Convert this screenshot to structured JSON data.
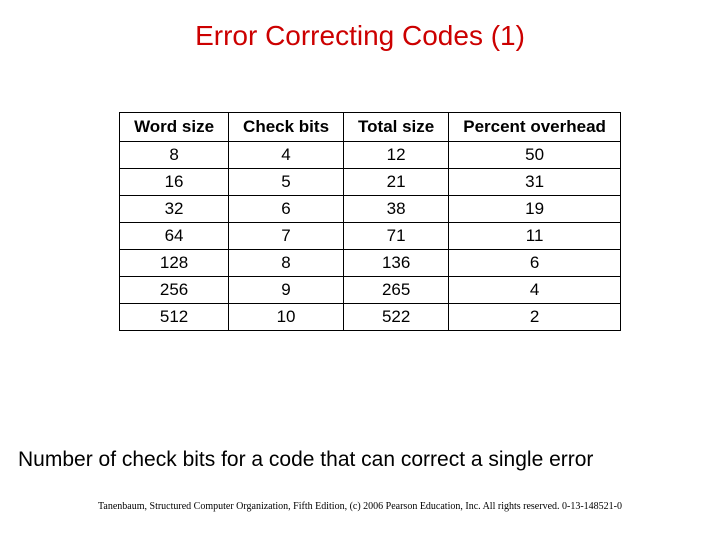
{
  "title": "Error Correcting Codes (1)",
  "chart_data": {
    "type": "table",
    "headers": [
      "Word size",
      "Check bits",
      "Total size",
      "Percent overhead"
    ],
    "rows": [
      [
        "8",
        "4",
        "12",
        "50"
      ],
      [
        "16",
        "5",
        "21",
        "31"
      ],
      [
        "32",
        "6",
        "38",
        "19"
      ],
      [
        "64",
        "7",
        "71",
        "11"
      ],
      [
        "128",
        "8",
        "136",
        "6"
      ],
      [
        "256",
        "9",
        "265",
        "4"
      ],
      [
        "512",
        "10",
        "522",
        "2"
      ]
    ]
  },
  "caption": "Number of check bits for a code that can correct a single error",
  "footer": "Tanenbaum, Structured Computer Organization, Fifth Edition, (c) 2006 Pearson Education, Inc. All rights reserved. 0-13-148521-0"
}
